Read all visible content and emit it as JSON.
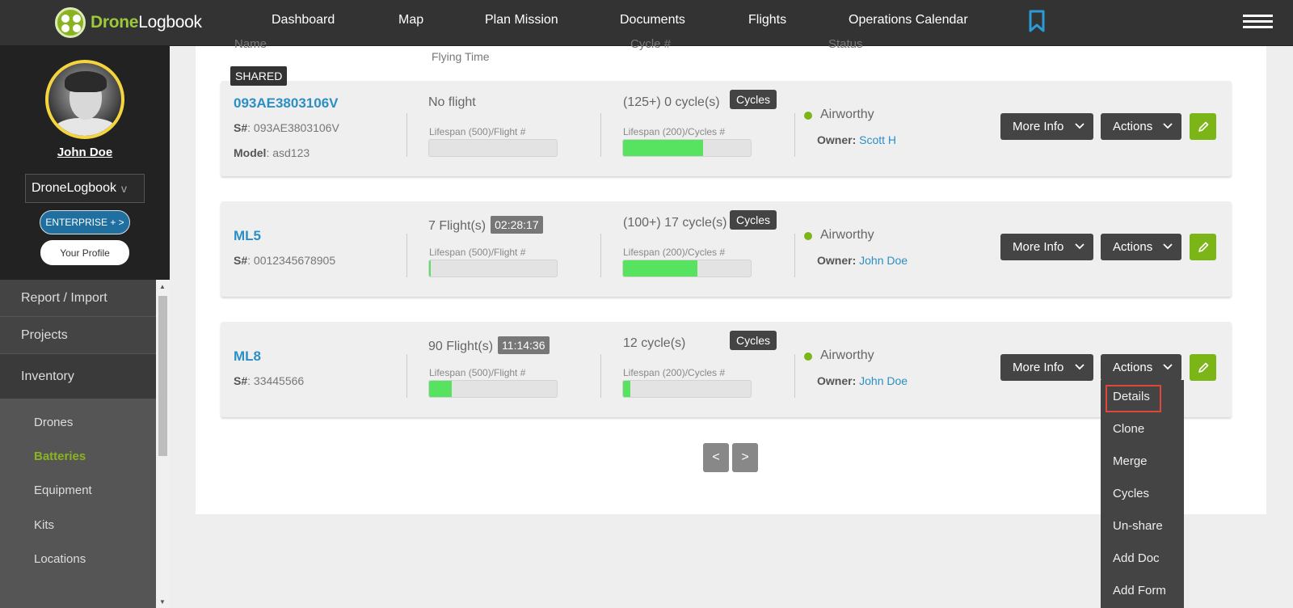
{
  "app": {
    "logo_drone": "Drone",
    "logo_logbook": "Logbook"
  },
  "nav": {
    "items": [
      "Dashboard",
      "Map",
      "Plan Mission",
      "Documents",
      "Flights",
      "Operations Calendar"
    ]
  },
  "sidebar": {
    "user_name": "John Doe",
    "org_select": "DroneLogbook",
    "enterprise_button": "ENTERPRISE + >",
    "profile_button": "Your Profile",
    "menu": [
      "Report / Import",
      "Projects",
      "Inventory"
    ],
    "submenu": [
      "Drones",
      "Batteries",
      "Equipment",
      "Kits",
      "Locations"
    ],
    "active_submenu": "Batteries"
  },
  "table": {
    "headers": {
      "name": "Name",
      "flying_time": "Flying Time",
      "cycle": "Cycle #",
      "status": "Status"
    },
    "shared_badge": "SHARED",
    "cycles_button": "Cycles",
    "more_info_button": "More Info",
    "actions_button": "Actions",
    "lifespan_flight_label": "Lifespan (500)/Flight #",
    "lifespan_cycles_label": "Lifespan (200)/Cycles #",
    "rows": [
      {
        "name": "093AE3803106V",
        "serial_label": "S#",
        "serial": ": 093AE3803106V",
        "model_label": "Model",
        "model": ": asd123",
        "flights": "No flight",
        "flight_time": "",
        "flight_progress": 0,
        "cycles": "(125+) 0 cycle(s)",
        "cycle_progress": 0.625,
        "status": "Airworthy",
        "owner_label": "Owner:",
        "owner": "Scott H"
      },
      {
        "name": "ML5",
        "serial_label": "S#",
        "serial": ": 0012345678905",
        "flights": "7 Flight(s)",
        "flight_time": "02:28:17",
        "flight_progress": 0.014,
        "cycles": "(100+) 17 cycle(s)",
        "cycle_progress": 0.585,
        "status": "Airworthy",
        "owner_label": "Owner:",
        "owner": "John Doe"
      },
      {
        "name": "ML8",
        "serial_label": "S#",
        "serial": ": 33445566",
        "flights": "90 Flight(s)",
        "flight_time": "11:14:36",
        "flight_progress": 0.18,
        "cycles": "12 cycle(s)",
        "cycle_progress": 0.06,
        "status": "Airworthy",
        "owner_label": "Owner:",
        "owner": "John Doe"
      }
    ]
  },
  "pagination": {
    "prev": "<",
    "next": ">"
  },
  "actions_dropdown": {
    "items": [
      "Details",
      "Clone",
      "Merge",
      "Cycles",
      "Un-share",
      "Add Doc",
      "Add Form"
    ],
    "highlighted": "Details"
  },
  "colors": {
    "accent_green": "#7cb518",
    "link_blue": "#2b8fc4",
    "progress_green": "#57e35f",
    "highlight_red": "#e0463a"
  }
}
